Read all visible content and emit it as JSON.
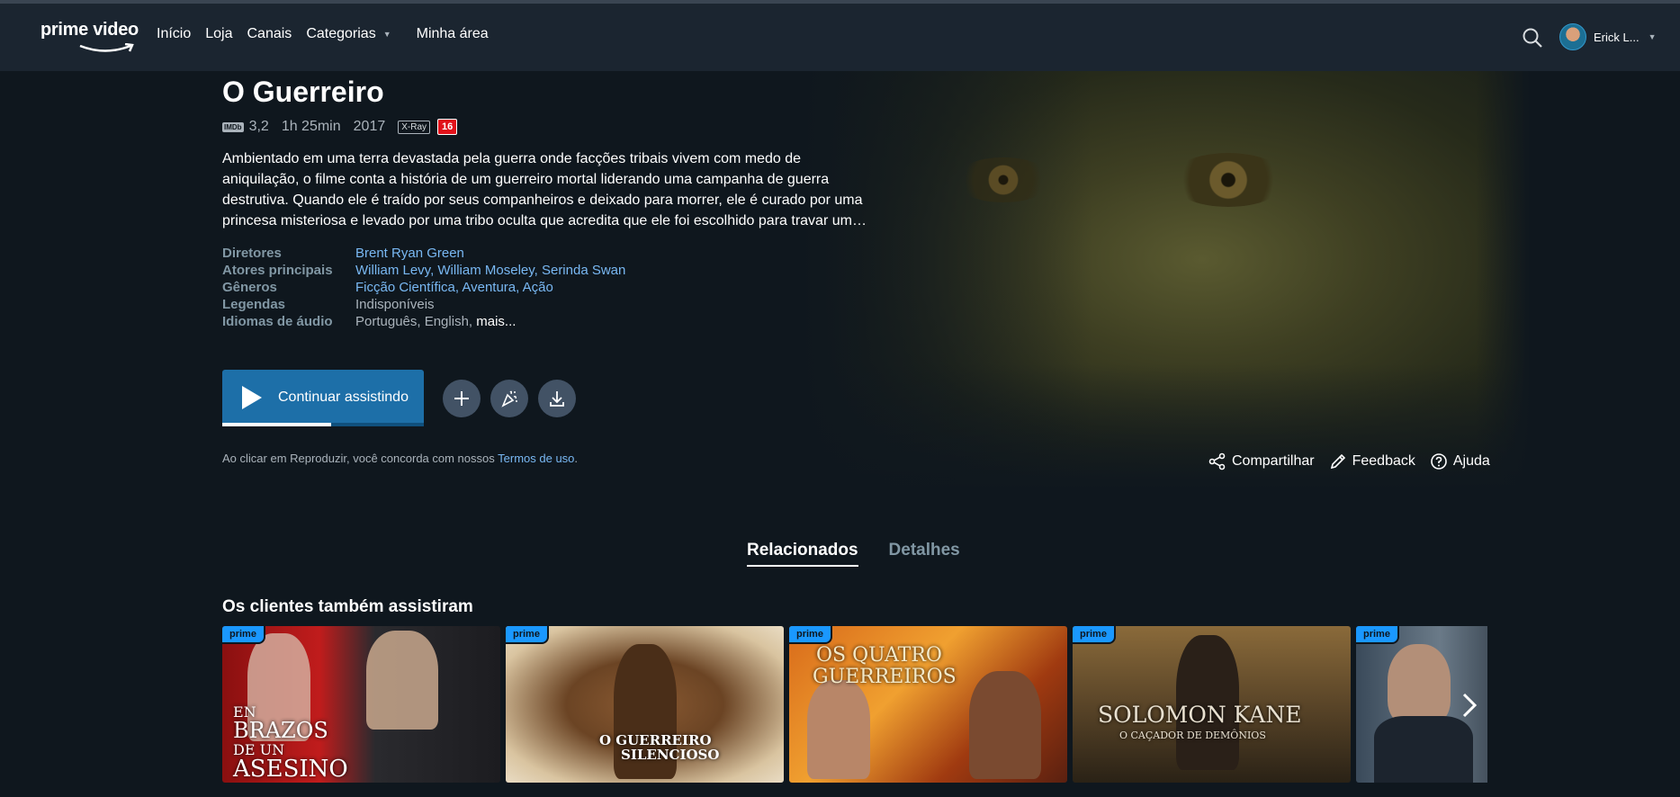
{
  "nav": {
    "logo_text": "prime video",
    "links": [
      "Início",
      "Loja",
      "Canais",
      "Categorias",
      "Minha área"
    ],
    "user_name": "Erick L..."
  },
  "title": {
    "name": "O Guerreiro",
    "imdb_label": "IMDb",
    "imdb_rating": "3,2",
    "duration": "1h 25min",
    "year": "2017",
    "xray": "X-Ray",
    "age_rating": "16",
    "synopsis": "Ambientado em uma terra devastada pela guerra onde facções tribais vivem com medo de aniquilação, o filme conta a história de um guerreiro mortal liderando uma campanha de guerra destrutiva. Quando ele é traído por seus companheiros e deixado para morrer, ele é curado por uma princesa misteriosa e levado por uma tribo oculta que acredita que ele foi escolhido para travar um…"
  },
  "details": {
    "directors_label": "Diretores",
    "directors": "Brent Ryan Green",
    "actors_label": "Atores principais",
    "actors": "William Levy, William Moseley, Serinda Swan",
    "genres_label": "Gêneros",
    "genres": "Ficção Científica, Aventura, Ação",
    "subtitles_label": "Legendas",
    "subtitles": "Indisponíveis",
    "audio_label": "Idiomas de áudio",
    "audio": "Português, English,",
    "audio_more": "mais..."
  },
  "player": {
    "play_label": "Continuar assistindo",
    "progress_fraction": 0.54,
    "terms_text": "Ao clicar em Reproduzir, você concorda com nossos",
    "terms_link": "Termos de uso",
    "terms_end": "."
  },
  "actions": {
    "share": "Compartilhar",
    "feedback": "Feedback",
    "help": "Ajuda"
  },
  "tabs": [
    "Relacionados",
    "Detalhes"
  ],
  "related": {
    "title": "Os clientes também assistiram",
    "badge": "prime",
    "cards": [
      {
        "line1": "EN",
        "line2": "BRAZOS",
        "line3": "DE UN",
        "line4": "ASESINO"
      },
      {
        "line1": "O GUERREIRO",
        "line2": "SILENCIOSO"
      },
      {
        "line1": "OS QUATRO",
        "line2": "GUERREIROS"
      },
      {
        "line1": "SOLOMON KANE",
        "line2": "O CAÇADOR DE DEMÔNIOS"
      },
      {
        "line1": ""
      }
    ]
  }
}
